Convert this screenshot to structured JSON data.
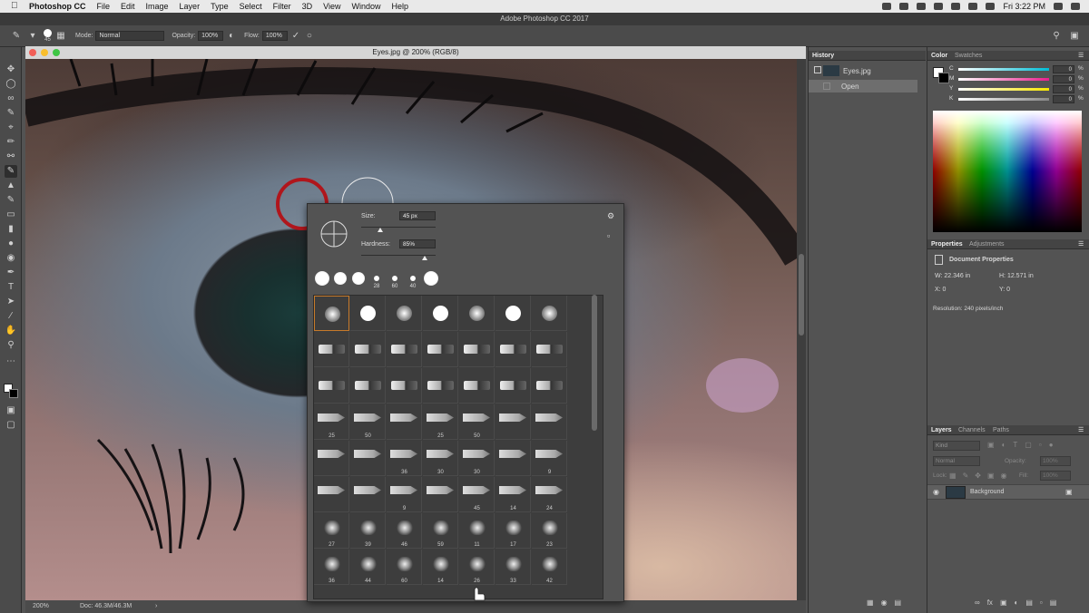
{
  "menubar": {
    "app": "Photoshop CC",
    "items": [
      "File",
      "Edit",
      "Image",
      "Layer",
      "Type",
      "Select",
      "Filter",
      "3D",
      "View",
      "Window",
      "Help"
    ],
    "clock": "Fri 3:22 PM"
  },
  "app_title": "Adobe Photoshop CC 2017",
  "options_bar": {
    "brush_size": "45",
    "mode_label": "Mode:",
    "mode_value": "Normal",
    "opacity_label": "Opacity:",
    "opacity_value": "100%",
    "flow_label": "Flow:",
    "flow_value": "100%"
  },
  "document": {
    "title": "Eyes.jpg @ 200% (RGB/8)",
    "zoom": "200%",
    "doc_size": "Doc: 46.3M/46.3M"
  },
  "brush_picker": {
    "size_label": "Size:",
    "size_value": "45 px",
    "hardness_label": "Hardness:",
    "hardness_value": "85%",
    "size_fraction": 0.25,
    "hardness_fraction": 0.85,
    "recent_brushes": [
      "",
      "",
      "",
      "28",
      "60",
      "40",
      ""
    ],
    "grid_labels": [
      [
        "",
        "",
        "",
        "",
        "",
        "",
        ""
      ],
      [
        "",
        "",
        "",
        "",
        "",
        "",
        ""
      ],
      [
        "",
        "",
        "",
        "",
        "",
        "",
        ""
      ],
      [
        "25",
        "50",
        "",
        "25",
        "50",
        "",
        ""
      ],
      [
        "",
        "",
        "36",
        "30",
        "30",
        "",
        "9"
      ],
      [
        "",
        "",
        "9",
        "",
        "45",
        "14",
        "24"
      ],
      [
        "27",
        "39",
        "46",
        "59",
        "11",
        "17",
        "23"
      ],
      [
        "36",
        "44",
        "60",
        "14",
        "26",
        "33",
        "42"
      ]
    ]
  },
  "history": {
    "tab": "History",
    "snapshot": "Eyes.jpg",
    "state": "Open"
  },
  "color_panel": {
    "tabs": [
      "Color",
      "Swatches"
    ],
    "channels": [
      {
        "label": "C",
        "value": "0",
        "unit": "%",
        "color": "#00bcd4"
      },
      {
        "label": "M",
        "value": "0",
        "unit": "%",
        "color": "#e91e8c"
      },
      {
        "label": "Y",
        "value": "0",
        "unit": "%",
        "color": "#f6e600"
      },
      {
        "label": "K",
        "value": "0",
        "unit": "%",
        "color": "#888888"
      }
    ]
  },
  "properties": {
    "tabs": [
      "Properties",
      "Adjustments"
    ],
    "title": "Document Properties",
    "w": "W: 22.346 in",
    "h": "H: 12.571 in",
    "x": "X: 0",
    "y": "Y: 0",
    "resolution": "Resolution: 240 pixels/inch"
  },
  "layers": {
    "tabs": [
      "Layers",
      "Channels",
      "Paths"
    ],
    "kind": "Kind",
    "blend": "Normal",
    "opacity_label": "Opacity:",
    "opacity_value": "100%",
    "lock_label": "Lock:",
    "fill_label": "Fill:",
    "fill_value": "100%",
    "layer_name": "Background"
  },
  "colors": {
    "accent_selection": "#c77a2a",
    "brush_ring": "#b0161c"
  }
}
